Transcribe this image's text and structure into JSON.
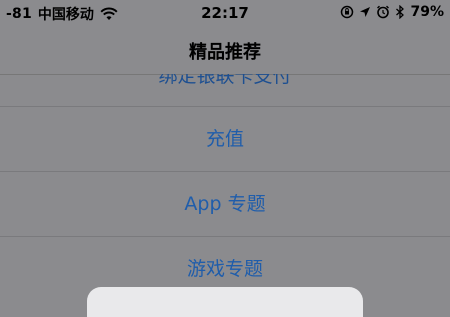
{
  "status_bar": {
    "signal": "-81",
    "carrier": "中国移动",
    "time": "22:17",
    "battery_percent": "79%",
    "icons": [
      "wifi-icon",
      "orientation-lock-icon",
      "location-arrow-icon",
      "alarm-icon",
      "bluetooth-icon",
      "battery-icon"
    ]
  },
  "nav": {
    "title": "精品推荐"
  },
  "menu": {
    "items": [
      {
        "label": "绑定银联卡支付"
      },
      {
        "label": "充值"
      },
      {
        "label": "App 专题"
      },
      {
        "label": "游戏专题"
      }
    ]
  },
  "colors": {
    "overlay_bg": "#8b8b8e",
    "link_blue": "#1f5dab",
    "sheet_bg": "#e9e9eb"
  }
}
